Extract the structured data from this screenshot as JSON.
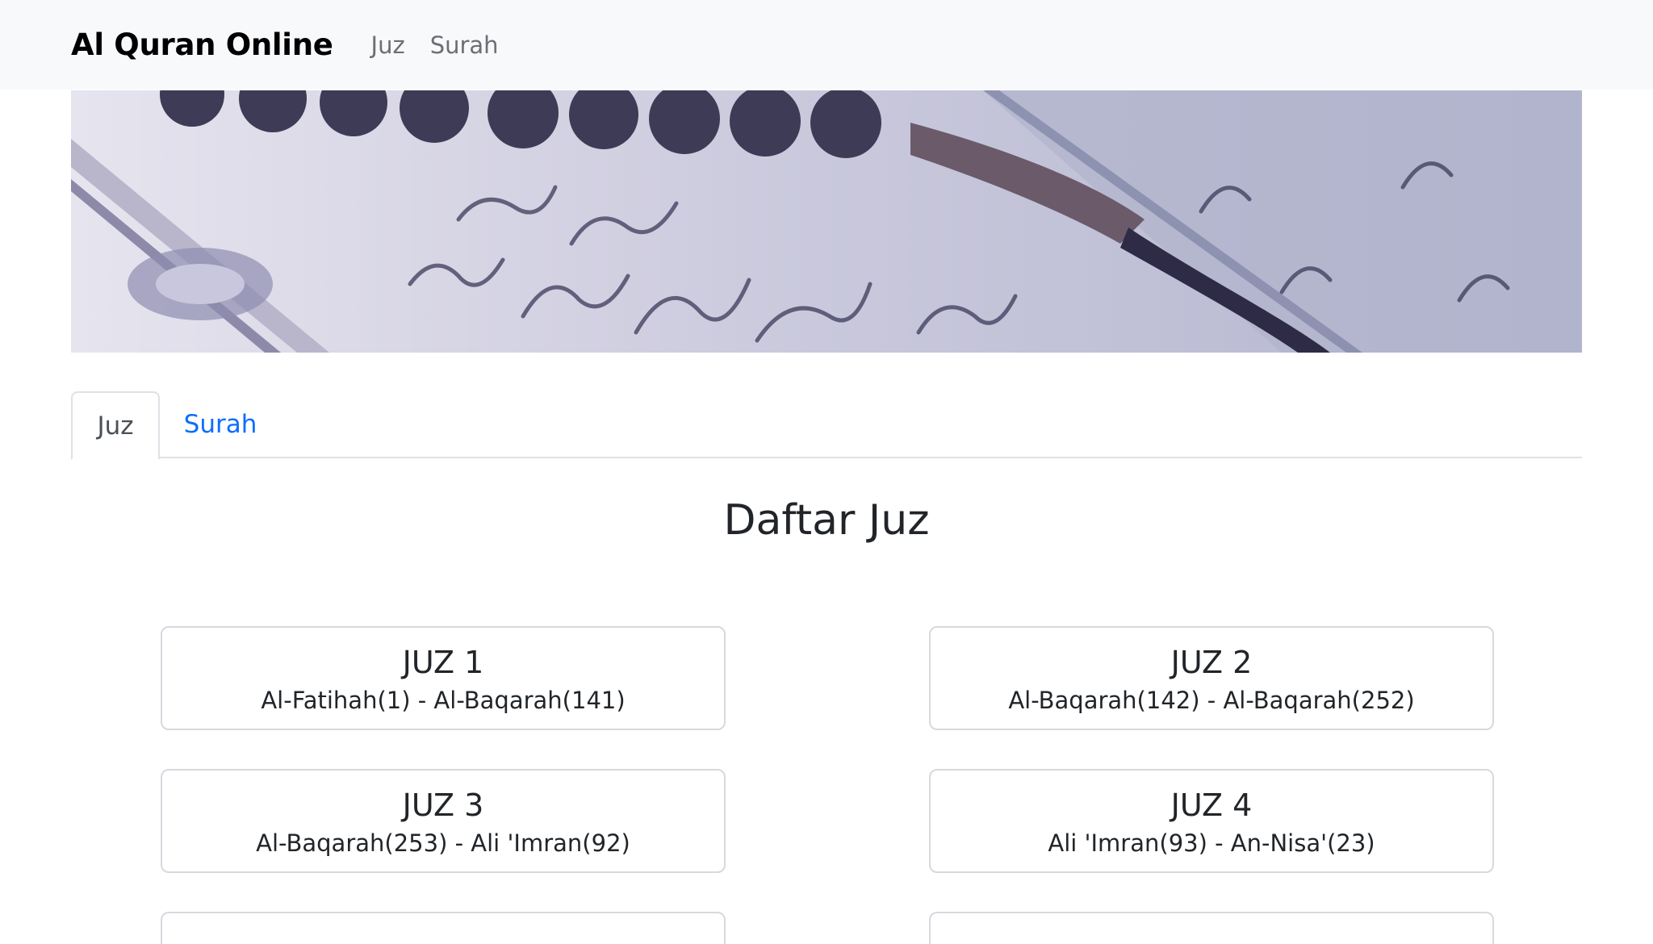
{
  "navbar": {
    "brand": "Al Quran Online",
    "links": [
      "Juz",
      "Surah"
    ]
  },
  "hero": {
    "image": "quran-prayer-beads-banner"
  },
  "tabs": [
    {
      "label": "Juz",
      "active": true
    },
    {
      "label": "Surah",
      "active": false
    }
  ],
  "heading": "Daftar Juz",
  "juz_list": [
    {
      "title": "JUZ 1",
      "range": "Al-Fatihah(1) - Al-Baqarah(141)"
    },
    {
      "title": "JUZ 2",
      "range": "Al-Baqarah(142) - Al-Baqarah(252)"
    },
    {
      "title": "JUZ 3",
      "range": "Al-Baqarah(253) - Ali 'Imran(92)"
    },
    {
      "title": "JUZ 4",
      "range": "Ali 'Imran(93) - An-Nisa'(23)"
    }
  ],
  "colors": {
    "navbar_bg": "#f8f9fa",
    "link_active": "#0d6efd",
    "border": "#dee2e6"
  }
}
